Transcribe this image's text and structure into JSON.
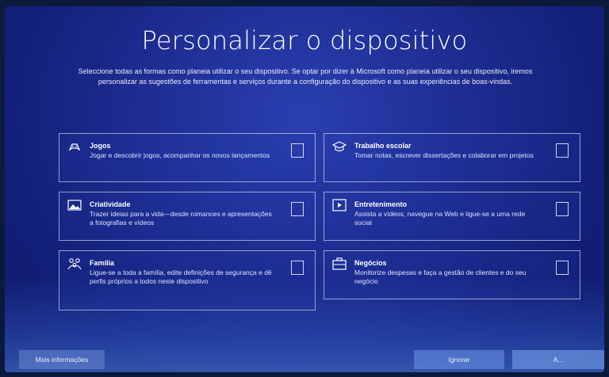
{
  "page": {
    "title": "Personalizar o dispositivo",
    "subtitle": "Seleccione todas as formas como planeia utilizar o seu dispositivo. Se optar por dizer à Microsoft como planeia utilizar o seu dispositivo, iremos personalizar as sugestões de ferramentas e serviços durante a configuração do dispositivo e as suas experiências de boas-vindas."
  },
  "options": [
    {
      "title": "Jogos",
      "description": "Jogar e descobrir jogos, acompanhar os novos lançamentos",
      "icon": "gamepad-icon",
      "checked": false
    },
    {
      "title": "Trabalho escolar",
      "description": "Tomar notas, escrever dissertações e colaborar em projetos",
      "icon": "graduation-cap-icon",
      "checked": false
    },
    {
      "title": "Criatividade",
      "description": "Trazer ideias para a vida—desde romances e apresentações a fotografias e vídeos",
      "icon": "image-icon",
      "checked": false
    },
    {
      "title": "Entretenimento",
      "description": "Assista a vídeos, navegue na Web e ligue-se a uma rede social",
      "icon": "media-icon",
      "checked": false
    },
    {
      "title": "Família",
      "description": "Ligue-se a toda a família, edite definições de segurança e dê perfis próprios a todos neste dispositivo",
      "icon": "family-icon",
      "checked": false
    },
    {
      "title": "Negócios",
      "description": "Monitorize despesas e faça a gestão de clientes e do seu negócio",
      "icon": "briefcase-icon",
      "checked": false
    }
  ],
  "buttons": {
    "more_info": "Mais informações",
    "skip": "Ignorar",
    "accept": "A..."
  }
}
